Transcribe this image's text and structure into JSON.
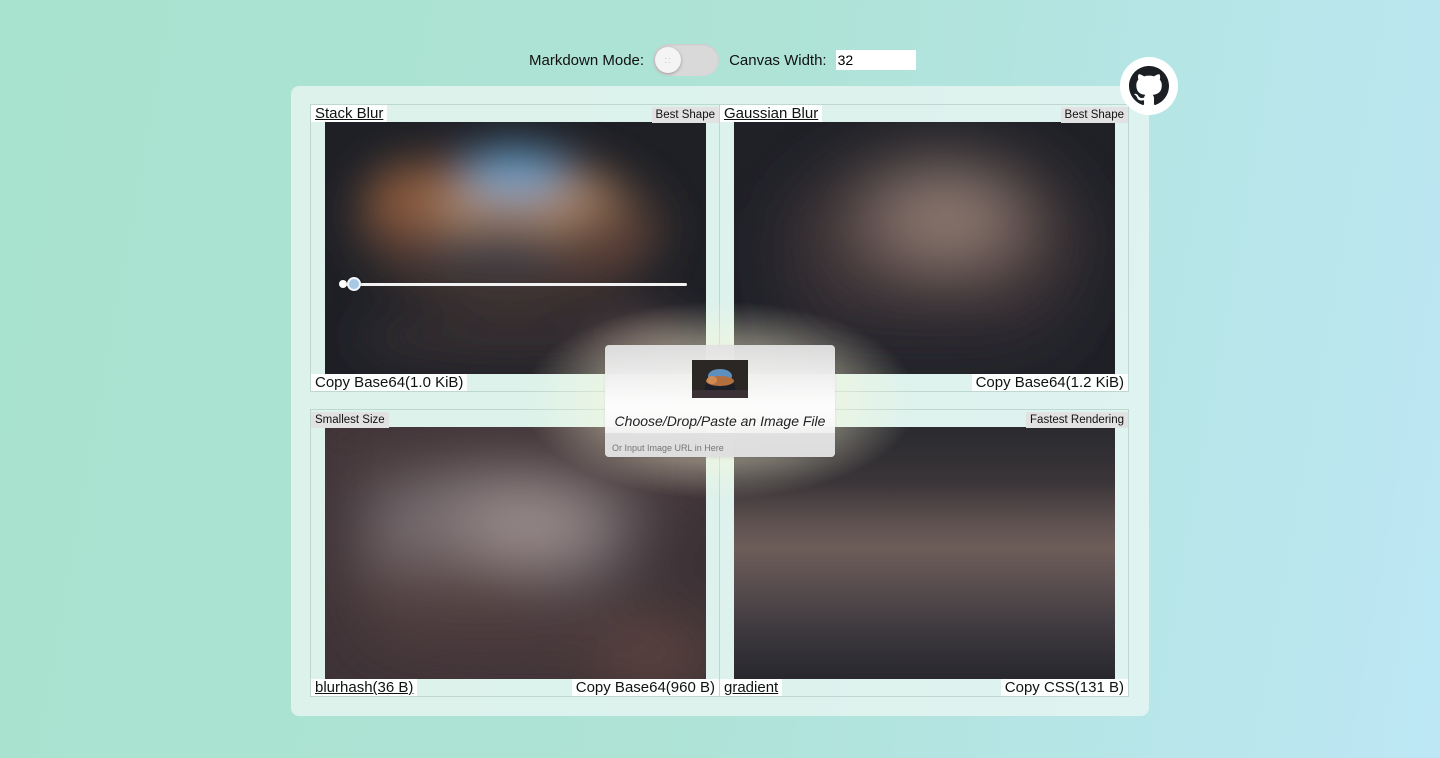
{
  "toolbar": {
    "markdown_mode_label": "Markdown Mode:",
    "markdown_mode_on": false,
    "canvas_width_label": "Canvas Width:",
    "canvas_width_value": "32"
  },
  "github": {
    "icon": "github-icon"
  },
  "panels": [
    {
      "title": "Stack Blur",
      "tag": "Best Shape",
      "copy_label": "Copy Base64(1.0 KiB)",
      "slider_value": 0.02
    },
    {
      "title": "Gaussian Blur",
      "tag": "Best Shape",
      "copy_label": "Copy Base64(1.2 KiB)"
    },
    {
      "title": "blurhash(36 B)",
      "tag": "Smallest Size",
      "copy_label": "Copy Base64(960 B)"
    },
    {
      "title": "gradient",
      "tag": "Fastest Rendering",
      "copy_label": "Copy CSS(131 B)"
    }
  ],
  "dropzone": {
    "prompt": "Choose/Drop/Paste an Image File",
    "url_placeholder": "Or Input Image URL in Here"
  }
}
